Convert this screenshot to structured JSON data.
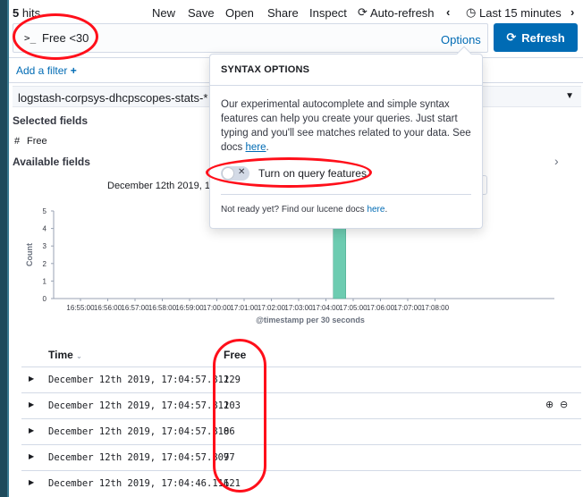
{
  "topbar": {
    "hits_count": "5",
    "hits_label": "hits",
    "menu": [
      "New",
      "Save",
      "Open",
      "Share",
      "Inspect"
    ],
    "auto_refresh": "Auto-refresh",
    "time_range": "Last 15 minutes"
  },
  "query": {
    "prompt": ">_",
    "text": "Free <30",
    "options_label": "Options",
    "refresh_label": "Refresh",
    "add_filter": "Add a filter"
  },
  "sidebar": {
    "index_pattern": "logstash-corpsys-dhcpscopes-stats-*",
    "selected_fields_title": "Selected fields",
    "selected_fields": [
      {
        "type": "#",
        "name": "Free"
      }
    ],
    "available_fields_title": "Available fields"
  },
  "popover": {
    "title": "SYNTAX OPTIONS",
    "body_prefix": "Our experimental autocomplete and simple syntax features can help you create your queries. Just start typing and you'll see matches related to your data. See docs ",
    "body_link": "here",
    "body_suffix": ".",
    "toggle_label": "Turn on query features",
    "footer_prefix": "Not ready yet? Find our lucene docs ",
    "footer_link": "here",
    "footer_suffix": "."
  },
  "chart_data": {
    "type": "bar",
    "title": "December 12th 2019, 16",
    "x": [
      "16:55:00",
      "16:56:00",
      "16:57:00",
      "16:58:00",
      "16:59:00",
      "17:00:00",
      "17:01:00",
      "17:02:00",
      "17:03:00",
      "17:04:00",
      "17:05:00",
      "17:06:00",
      "17:07:00",
      "17:08:00"
    ],
    "bars": [
      {
        "x": "17:04:30",
        "value": 5
      }
    ],
    "ylabel": "Count",
    "xlabel": "@timestamp per 30 seconds",
    "yticks": [
      0,
      1,
      2,
      3,
      4,
      5
    ],
    "ylim": [
      0,
      5
    ],
    "bar_color": "#6dccb1"
  },
  "table": {
    "columns": [
      "Time",
      "Free"
    ],
    "rows": [
      {
        "time": "December 12th 2019, 17:04:57.811",
        "free": "229"
      },
      {
        "time": "December 12th 2019, 17:04:57.811",
        "free": "203"
      },
      {
        "time": "December 12th 2019, 17:04:57.810",
        "free": "86"
      },
      {
        "time": "December 12th 2019, 17:04:57.809",
        "free": "77"
      },
      {
        "time": "December 12th 2019, 17:04:46.116",
        "free": "121"
      }
    ]
  },
  "colors": {
    "accent": "#006bb4",
    "annotation": "#ff0f1a"
  }
}
